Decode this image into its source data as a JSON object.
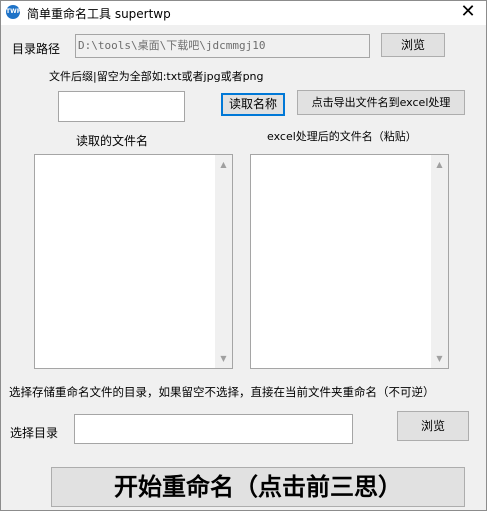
{
  "window": {
    "title": "简单重命名工具 supertwp",
    "icon_text": "TWP",
    "close_glyph": "✕"
  },
  "dir": {
    "label": "目录路径",
    "value": "D:\\tools\\桌面\\下载吧\\jdcmmgj10",
    "browse_label": "浏览"
  },
  "suffix": {
    "hint": "文件后缀|留空为全部如:txt或者jpg或者png",
    "value": "",
    "read_names_label": "读取名称",
    "export_label": "点击导出文件名到excel处理"
  },
  "lists": {
    "left_title": "读取的文件名",
    "right_title": "excel处理后的文件名（粘贴）"
  },
  "output": {
    "hint": "选择存储重命名文件的目录，如果留空不选择，直接在当前文件夹重命名（不可逆）",
    "label": "选择目录",
    "value": "",
    "browse_label": "浏览"
  },
  "start_button": "开始重命名（点击前三思）"
}
